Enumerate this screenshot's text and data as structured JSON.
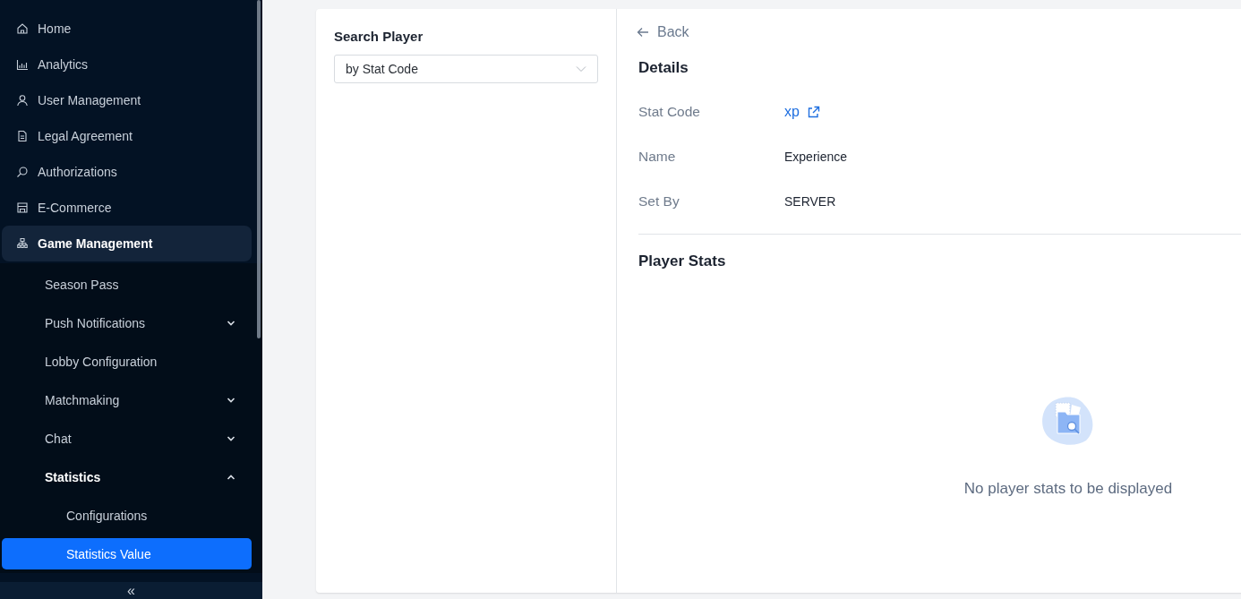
{
  "sidebar": {
    "items": [
      {
        "label": "Home",
        "selected": false
      },
      {
        "label": "Analytics",
        "selected": false
      },
      {
        "label": "User Management",
        "selected": false
      },
      {
        "label": "Legal Agreement",
        "selected": false
      },
      {
        "label": "Authorizations",
        "selected": false
      },
      {
        "label": "E-Commerce",
        "selected": false
      },
      {
        "label": "Game Management",
        "selected": true,
        "children": [
          {
            "label": "Season Pass",
            "selected": false
          },
          {
            "label": "Push Notifications",
            "selected": false,
            "expanded": false
          },
          {
            "label": "Lobby Configuration",
            "selected": false
          },
          {
            "label": "Matchmaking",
            "selected": false,
            "expanded": false
          },
          {
            "label": "Chat",
            "selected": false,
            "expanded": false
          },
          {
            "label": "Statistics",
            "selected": false,
            "expanded": true,
            "children": [
              {
                "label": "Configurations",
                "selected": false
              },
              {
                "label": "Statistics Value",
                "selected": true
              }
            ]
          }
        ]
      }
    ],
    "collapse": "«"
  },
  "search_panel": {
    "title": "Search Player",
    "select": {
      "value": "by Stat Code"
    }
  },
  "details": {
    "back": "Back",
    "title": "Details",
    "fields": [
      {
        "label": "Stat Code",
        "value": "xp",
        "kind": "link"
      },
      {
        "label": "Name",
        "value": "Experience",
        "kind": "text"
      },
      {
        "label": "Set By",
        "value": "SERVER",
        "kind": "text"
      }
    ]
  },
  "player_stats": {
    "title": "Player Stats",
    "empty_message": "No player stats to be displayed"
  }
}
